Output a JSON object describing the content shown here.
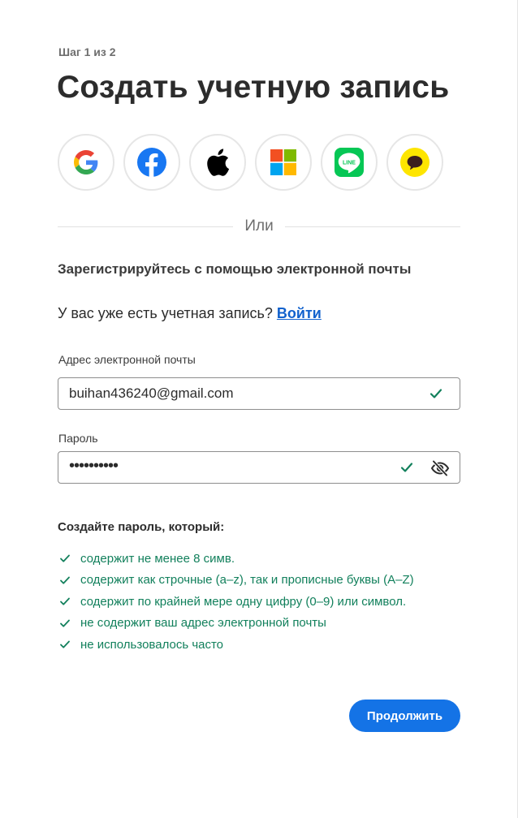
{
  "header": {
    "step": "Шаг 1 из 2",
    "title": "Создать учетную запись"
  },
  "social": {
    "providers": [
      {
        "icon": "google-icon"
      },
      {
        "icon": "facebook-icon"
      },
      {
        "icon": "apple-icon"
      },
      {
        "icon": "microsoft-icon"
      },
      {
        "icon": "line-icon",
        "text": "LINE"
      },
      {
        "icon": "kakaotalk-icon"
      }
    ]
  },
  "divider": {
    "text": "Или"
  },
  "email_signup": {
    "heading": "Зарегистрируйтесь с помощью электронной почты",
    "have_account_text": "У вас уже есть учетная запись?",
    "sign_in_link": "Войти"
  },
  "form": {
    "email_label": "Адрес электронной почты",
    "email_value": "buihan436240@gmail.com",
    "password_label": "Пароль",
    "password_value": "••••••••••"
  },
  "password_rules": {
    "title": "Создайте пароль, который:",
    "items": [
      "содержит не менее 8 симв.",
      "содержит как строчные (a–z), так и прописные буквы (A–Z)",
      "содержит по крайней мере одну цифру (0–9) или символ.",
      "не содержит ваш адрес электронной почты",
      "не использовалось часто"
    ]
  },
  "actions": {
    "continue_label": "Продолжить"
  },
  "colors": {
    "primary": "#1473e6",
    "link": "#1161cd",
    "success": "#12805c"
  }
}
